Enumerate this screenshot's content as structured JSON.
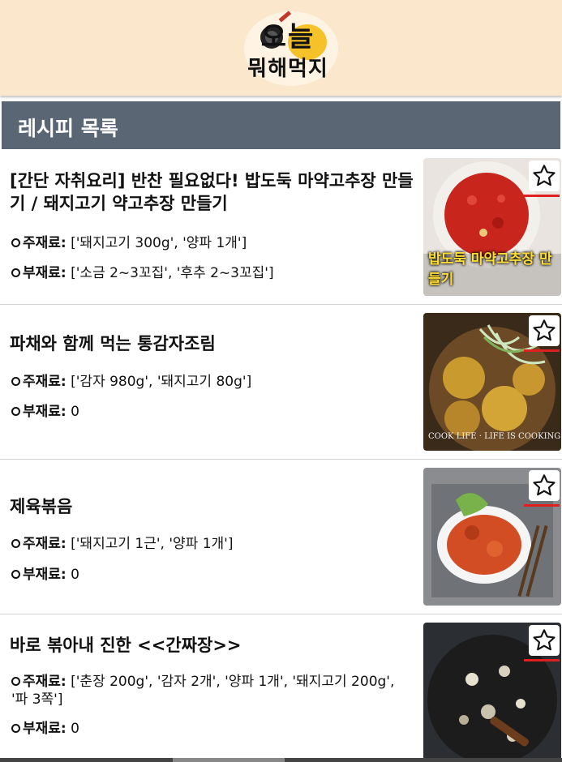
{
  "header": {
    "logo_line1": "오늘",
    "logo_line2": "뭐해먹지"
  },
  "section": {
    "title": "레시피 목록"
  },
  "labels": {
    "main": "주재료:",
    "sub": "부재료:"
  },
  "recipes": [
    {
      "title": "[간단 자취요리] 반찬 필요없다! 밥도둑 마약고추장 만들기 / 돼지고기 약고추장 만들기",
      "main": "['돼지고기 300g', '양파 1개']",
      "sub": "['소금 2~3꼬집', '후추 2~3꼬집']",
      "thumb_caption": "밥도둑 마약고추장 만들기",
      "thumb_icon": "red-gochujang-bowl"
    },
    {
      "title": "파채와 함께 먹는 통감자조림",
      "main": "['감자 980g', '돼지고기 80g']",
      "sub": "0",
      "thumb_caption": "COOK LIFE · LIFE IS COOKING",
      "thumb_icon": "braised-potatoes"
    },
    {
      "title": "제육볶음",
      "main": "['돼지고기 1근', '양파 1개']",
      "sub": "0",
      "thumb_icon": "spicy-pork-plate"
    },
    {
      "title": "바로 볶아내 진한 <<간짜장>>",
      "main": "['춘장 200g', '감자 2개', '양파 1개', '돼지고기 200g', '파 3쪽']",
      "sub": "0",
      "thumb_icon": "jjajang-wok"
    }
  ],
  "colors": {
    "header_bg": "#fbe7cc",
    "section_bar": "#5a6673",
    "favorite_underline": "#e02020"
  }
}
